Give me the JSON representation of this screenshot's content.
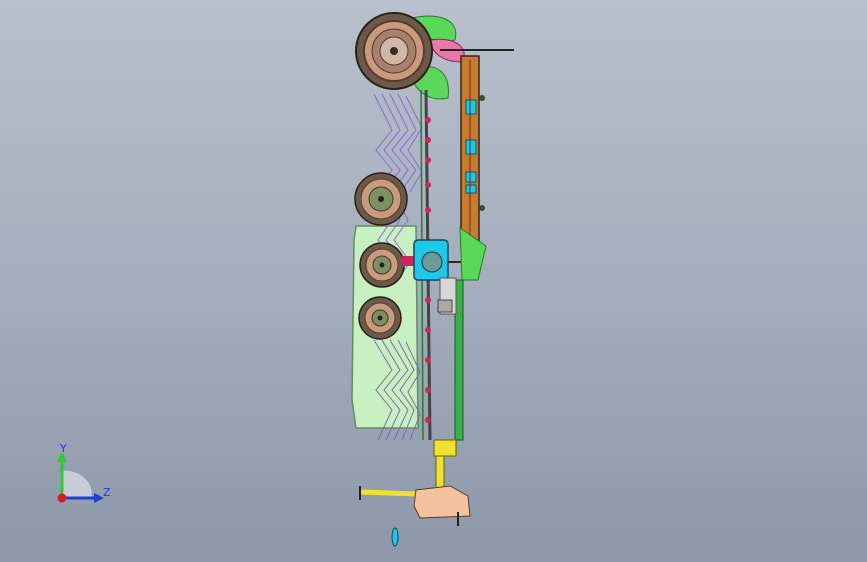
{
  "viewport": {
    "background_top": "#b9c0cc",
    "background_bottom": "#8c97a8"
  },
  "orientation_triad": {
    "y_label": "Y",
    "z_label": "Z",
    "y_color": "#2ecc2e",
    "z_color": "#1f3fd0",
    "x_color": "#d81b1b"
  },
  "model": {
    "colors": {
      "tire": "#6b5a4a",
      "tire_wall": "#c89a80",
      "hub": "#7f8f63",
      "tank": "#c8f0c0",
      "tank_edge": "#5f8f5f",
      "rake": "#8a6ad8",
      "frame_orange": "#c87a30",
      "frame_dark": "#5a3a1a",
      "accent_cyan": "#1ec8e8",
      "hitch_yellow": "#f0e030",
      "hitch_peach": "#f5c2a0",
      "leaf_green": "#5ad85a",
      "leaf_pink": "#e878a8",
      "chain_red": "#d0245a"
    }
  }
}
